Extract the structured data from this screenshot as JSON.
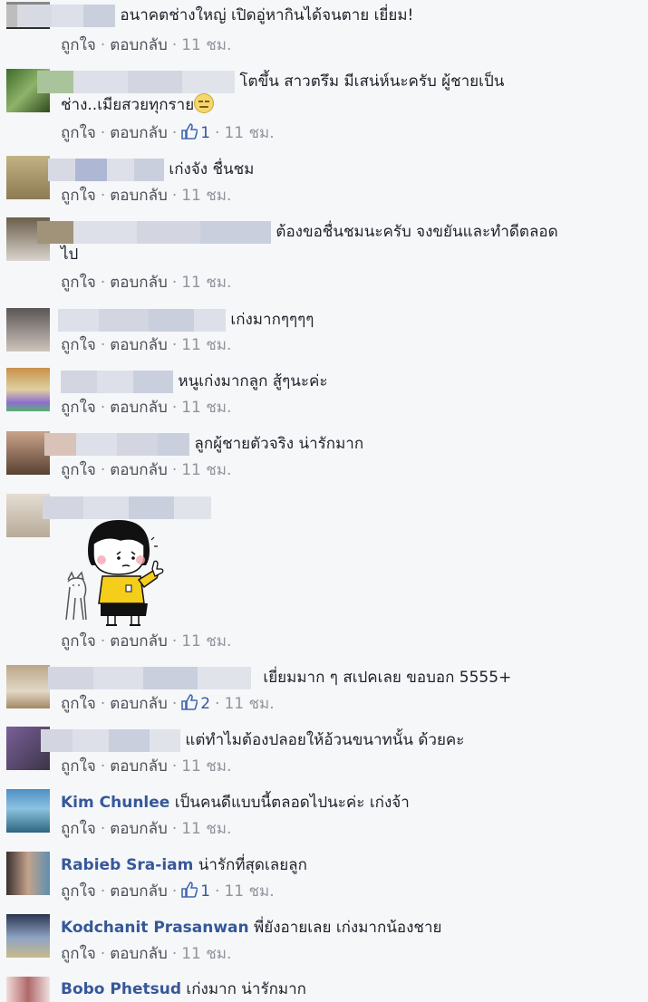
{
  "actions": {
    "like_label": "ถูกใจ",
    "reply_label": "ตอบกลับ",
    "separator": "·"
  },
  "comments": [
    {
      "name": "",
      "text": "อนาคตช่างใหญ่ เปิดอู่หากินได้จนตาย เยี่ยม!",
      "likes": "",
      "time": "11 ชม."
    },
    {
      "name": "",
      "text": "โตขึ้น สาวตรึม มีเสน่ห์นะครับ ผู้ชายเป็น",
      "text2": "ช่าง..เมียสวยทุกราย",
      "likes": "1",
      "time": "11 ชม."
    },
    {
      "name": "",
      "text": "เก่งจัง ชื่นชม",
      "likes": "",
      "time": "11 ชม."
    },
    {
      "name": "",
      "text": "ต้องขอชื่นชมนะครับ จงขยันและทำดีตลอด",
      "text2": "ไป",
      "likes": "",
      "time": "11 ชม."
    },
    {
      "name": "",
      "text": "เก่งมากๆๆๆๆ",
      "likes": "",
      "time": "11 ชม."
    },
    {
      "name": "",
      "text": "หนูเก่งมากลูก สู้ๆนะค่ะ",
      "likes": "",
      "time": "11 ชม."
    },
    {
      "name": "",
      "text": "ลูกผู้ชายตัวจริง น่ารักมาก",
      "likes": "",
      "time": "11 ชม."
    },
    {
      "name": "",
      "text": "",
      "likes": "",
      "time": "11 ชม."
    },
    {
      "name": "",
      "text": "เยี่ยมมาก ๆ สเปคเลย ขอบอก 5555+",
      "likes": "2",
      "time": "11 ชม."
    },
    {
      "name": "",
      "text": "แต่ทำไมต้องปลอยให้อ้วนขนาทนั้น ด้วยคะ",
      "likes": "",
      "time": "11 ชม."
    },
    {
      "name": "Kim Chunlee",
      "text": "เป็นคนดีแบบนี้ตลอดไปนะค่ะ เก่งจ้า",
      "likes": "",
      "time": "11 ชม."
    },
    {
      "name": "Rabieb Sra-iam",
      "text": "น่ารักที่สุดเลยลูก",
      "likes": "1",
      "time": "11 ชม."
    },
    {
      "name": "Kodchanit Prasanwan",
      "text": "พี่ยังอายเลย เก่งมากน้องชาย",
      "likes": "",
      "time": "11 ชม."
    },
    {
      "name": "Bobo Phetsud",
      "text": "เก่งมาก น่ารักมาก",
      "likes": "",
      "time": ""
    }
  ],
  "icons": {
    "like": "thumbs-up-icon",
    "emoji": "grinning-face-emoji",
    "sticker": "girl-thumbs-up-sticker"
  },
  "colors": {
    "name": "#365899",
    "link": "#4b4f56",
    "meta": "#90949c",
    "background": "#f6f7f9"
  }
}
